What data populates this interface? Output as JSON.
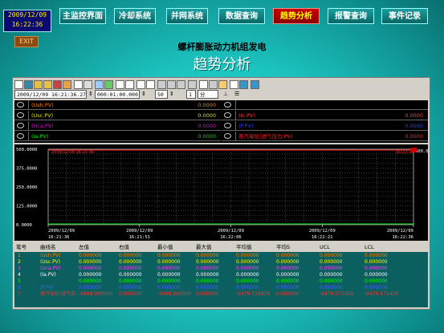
{
  "header": {
    "date": "2009/12/09",
    "time": "16:22:36",
    "exit_label": "EXIT"
  },
  "nav": [
    {
      "label": "主监控界面",
      "active": false
    },
    {
      "label": "冷却系统",
      "active": false
    },
    {
      "label": "并网系统",
      "active": false
    },
    {
      "label": "数据查询",
      "active": false
    },
    {
      "label": "趋势分析",
      "active": true
    },
    {
      "label": "报警查询",
      "active": false
    },
    {
      "label": "事件记录",
      "active": false
    }
  ],
  "page": {
    "subtitle": "螺杆膨胀动力机组发电",
    "title": "趋势分析"
  },
  "toolbar": {
    "start_time": "2009/12/09 16:21:36.272",
    "duration": "000:01:00.000",
    "step": "50",
    "count": "1",
    "unit": "分"
  },
  "legend": {
    "left": [
      {
        "name": "(Ush.PV)",
        "value": "0.0000",
        "color": "#ff7a00"
      },
      {
        "name": "(Usc.PV)",
        "value": "0.0000",
        "color": "#e0e000"
      },
      {
        "name": "(Uca.PV)",
        "value": "0.0000",
        "color": "#e000e0"
      },
      {
        "name": "(Ia.PV)",
        "value": "0.0000",
        "color": "#00e000"
      }
    ],
    "right": [
      {
        "name": "",
        "value": "",
        "color": "#ffffff"
      },
      {
        "name": "(Ic.PV)",
        "value": "0.0000",
        "color": "#ff4040"
      },
      {
        "name": "(P.PV)",
        "value": "0.0000",
        "color": "#2040ff"
      },
      {
        "name": "蒸汽母化(进气压力.PV)",
        "value": "0.0000",
        "color": "#ff2020"
      }
    ]
  },
  "chart_data": {
    "type": "line",
    "y_ticks": [
      "500.0000",
      "375.0000",
      "250.0000",
      "125.0000",
      "0.0000"
    ],
    "y_right": "500.0000",
    "top_label": "2009/12/09 16:21:36",
    "top_right_label": "16:22:36",
    "x_ticks": [
      {
        "date": "2009/12/09",
        "time": "16:21:36"
      },
      {
        "date": "2009/12/09",
        "time": "16:21:51"
      },
      {
        "date": "2009/12/09",
        "time": "16:22:06"
      },
      {
        "date": "2009/12/09",
        "time": "16:22:21"
      },
      {
        "date": "2009/12/09",
        "time": "16:22:36"
      }
    ],
    "ylim": [
      0,
      500
    ]
  },
  "table": {
    "headers": [
      "笔号",
      "曲线名",
      "左值",
      "右值",
      "最小值",
      "最大值",
      "平均值",
      "平均S",
      "UCL",
      "LCL"
    ],
    "rows": [
      {
        "idx": "1",
        "name": "(Ush.PV)",
        "vals": [
          "0.000000",
          "0.000000",
          "0.000000",
          "0.000000",
          "0.000000",
          "0.000000",
          "0.000000",
          "0.000000"
        ],
        "color": "#ff7a00"
      },
      {
        "idx": "2",
        "name": "(Usc.PV)",
        "vals": [
          "0.000000",
          "0.000000",
          "0.000000",
          "0.000000",
          "0.000000",
          "0.000000",
          "0.000000",
          "0.000000"
        ],
        "color": "#ffff00"
      },
      {
        "idx": "3",
        "name": "(Uca.PV)",
        "vals": [
          "0.000000",
          "0.000000",
          "0.000000",
          "0.000000",
          "0.000000",
          "0.000000",
          "0.000000",
          "0.000000"
        ],
        "color": "#ff40ff"
      },
      {
        "idx": "4",
        "name": "(Ia.PV)",
        "vals": [
          "0.000000",
          "0.000000",
          "0.000000",
          "0.000000",
          "0.000000",
          "0.000000",
          "0.000000",
          "0.000000"
        ],
        "color": "#ffffff"
      },
      {
        "idx": "5",
        "name": "",
        "vals": [
          "0.000000",
          "0.000000",
          "0.000000",
          "0.000000",
          "0.000000",
          "0.000000",
          "0.000000",
          "0.000000"
        ],
        "color": "#00ff00"
      },
      {
        "idx": "6",
        "name": "(P.PV)",
        "vals": [
          "0.000000",
          "0.000000",
          "0.000000",
          "0.000000",
          "0.000000",
          "0.000000",
          "0.000000",
          "0.000000"
        ],
        "color": "#4060ff"
      },
      {
        "idx": "7",
        "name": "蒸汽母化(进气压",
        "vals": [
          "-9999.000000",
          "0.000000",
          "-9999.000000",
          "0.000000",
          "-9479.726829",
          "0.000000",
          "-9479.571429",
          "-9479.571429"
        ],
        "color": "#ff3030"
      }
    ]
  }
}
